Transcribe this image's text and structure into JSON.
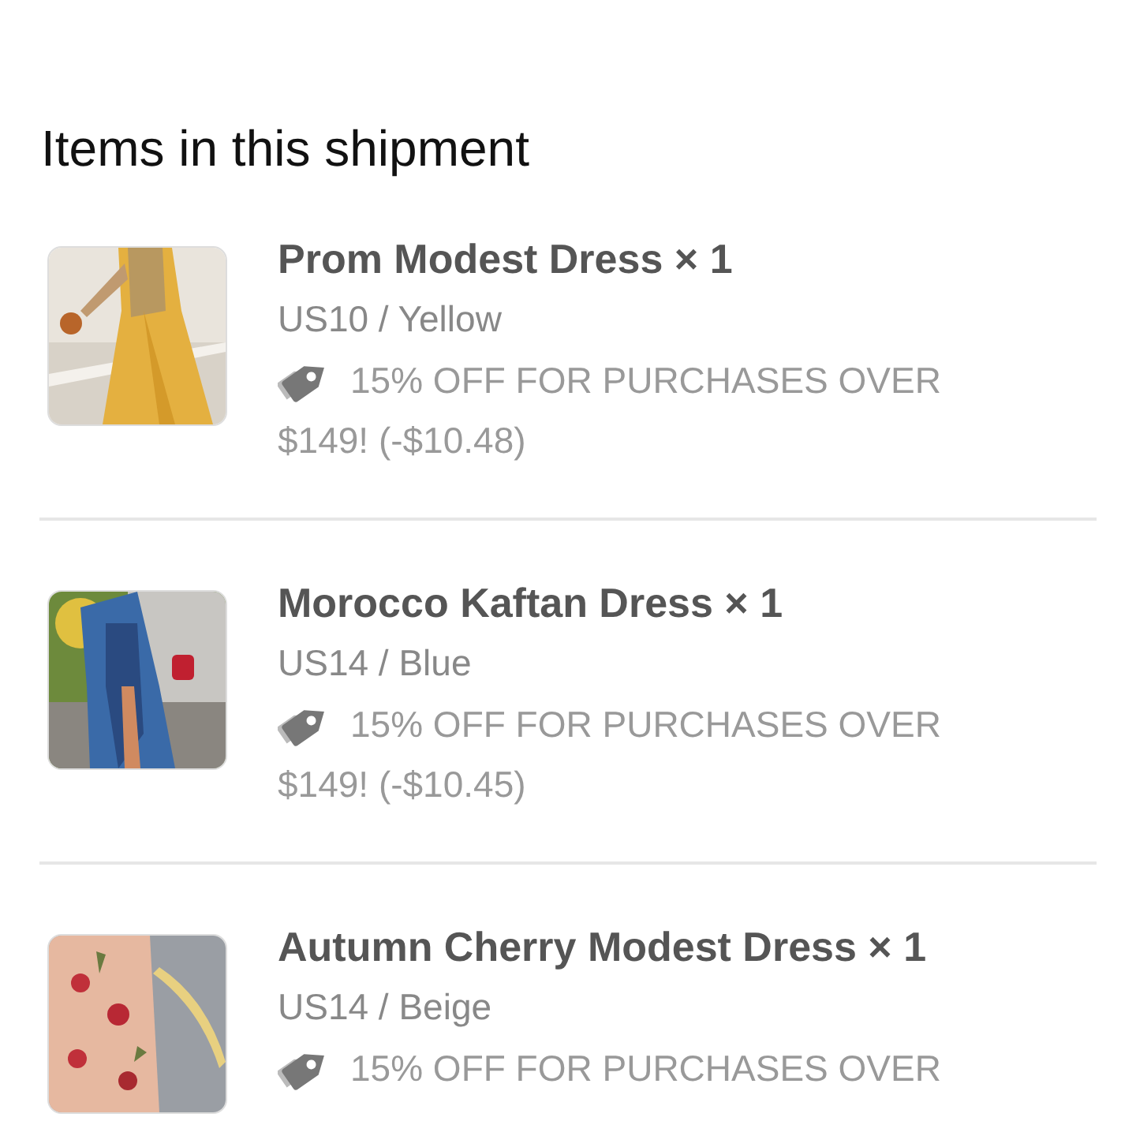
{
  "heading": "Items in this shipment",
  "items": [
    {
      "title": "Prom Modest Dress × 1",
      "variant": "US10 / Yellow",
      "discount": "15% OFF FOR PURCHASES OVER $149! (-$10.48)"
    },
    {
      "title": "Morocco Kaftan Dress × 1",
      "variant": "US14 / Blue",
      "discount": "15% OFF FOR PURCHASES OVER $149! (-$10.45)"
    },
    {
      "title": "Autumn Cherry Modest Dress × 1",
      "variant": "US14 / Beige",
      "discount": "15% OFF FOR PURCHASES OVER"
    }
  ]
}
